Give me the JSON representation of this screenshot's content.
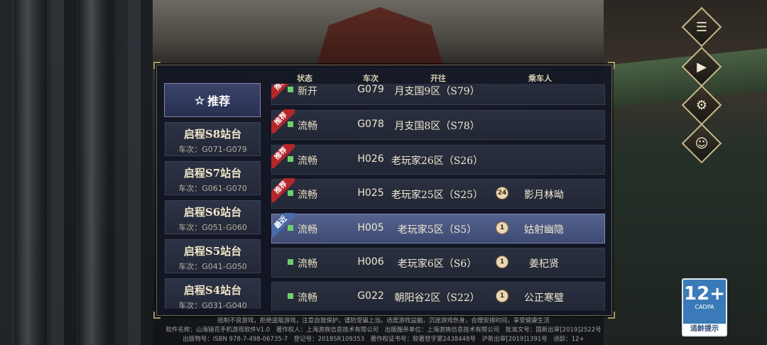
{
  "left_tabs": {
    "recommend_label": "推荐",
    "items": [
      {
        "title": "启程S8站台",
        "range": "车次：G071-G079"
      },
      {
        "title": "启程S7站台",
        "range": "车次：G061-G070"
      },
      {
        "title": "启程S6站台",
        "range": "车次：G051-G060"
      },
      {
        "title": "启程S5站台",
        "range": "车次：G041-G050"
      },
      {
        "title": "启程S4站台",
        "range": "车次：G031-G040"
      }
    ]
  },
  "list": {
    "headers": {
      "status": "状态",
      "code": "车次",
      "dest": "开往",
      "player": "乘车人"
    },
    "rows": [
      {
        "ribbon": "推荐",
        "status": "新开",
        "code": "G079",
        "dest": "月支国9区（S79）",
        "level": "",
        "player": ""
      },
      {
        "ribbon": "推荐",
        "status": "流畅",
        "code": "G078",
        "dest": "月支国8区（S78）",
        "level": "",
        "player": ""
      },
      {
        "ribbon": "推荐",
        "status": "流畅",
        "code": "H026",
        "dest": "老玩家26区（S26）",
        "level": "",
        "player": ""
      },
      {
        "ribbon": "推荐",
        "status": "流畅",
        "code": "H025",
        "dest": "老玩家25区（S25）",
        "level": "24",
        "player": "影月林呦"
      },
      {
        "ribbon": "最近",
        "status": "流畅",
        "code": "H005",
        "dest": "老玩家5区（S5）",
        "level": "1",
        "player": "姑射幽隐"
      },
      {
        "ribbon": "",
        "status": "流畅",
        "code": "H006",
        "dest": "老玩家6区（S6）",
        "level": "1",
        "player": "姜杞贤"
      },
      {
        "ribbon": "",
        "status": "流畅",
        "code": "G022",
        "dest": "朝阳谷2区（S22）",
        "level": "1",
        "player": "公正寒璧"
      }
    ]
  },
  "side_icons": [
    "list-icon",
    "video-icon",
    "settings-icon",
    "account-icon"
  ],
  "age_badge": {
    "big": "12+",
    "small": "CADPA",
    "tip": "适龄提示"
  },
  "footer": {
    "line1": "抵制不良游戏，拒绝盗版游戏，注意自我保护，谨防受骗上当。适度游戏益脑，沉迷游戏伤身，合理安排时间，享受健康生活",
    "line2": "软件名称：山海镜花手机游戏软件V1.0　著作权人：上海游族信息技术有限公司　出版服务单位：上海游族信息技术有限公司　批准文号：国新出审[2019]2522号",
    "line3": "出版物号：ISBN 978-7-498-06735-7　登记号：2018SR109353　著作权证书号：软著登字第2438448号　沪新出审[2019]1391号　适龄：12+"
  },
  "colors": {
    "status_dot": "#6ed06a",
    "ribbon_red": "#b3262a",
    "ribbon_blue": "#4a6aa8",
    "selected_row": "#4e5b86"
  }
}
